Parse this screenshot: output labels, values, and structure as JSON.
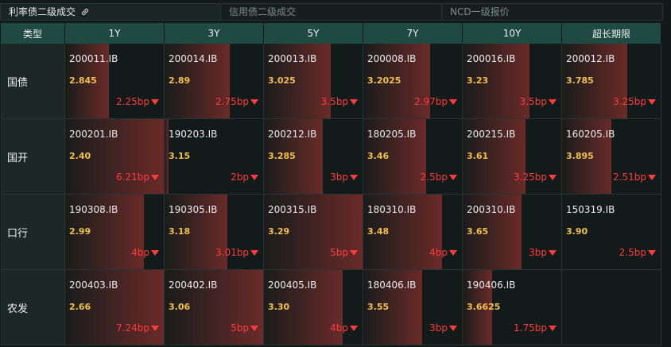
{
  "tabs": [
    {
      "label": "利率债二级成交",
      "active": true
    },
    {
      "label": "信用债二级成交",
      "active": false
    },
    {
      "label": "NCD一级报价",
      "active": false
    }
  ],
  "columns": [
    "类型",
    "1Y",
    "3Y",
    "5Y",
    "7Y",
    "10Y",
    "超长期限"
  ],
  "rows": [
    {
      "label": "国债",
      "cells": [
        {
          "code": "200011.IB",
          "yield": "2.845",
          "change": "2.25bp",
          "fill": 0.44
        },
        {
          "code": "200014.IB",
          "yield": "2.89",
          "change": "2.75bp",
          "fill": 0.66
        },
        {
          "code": "200013.IB",
          "yield": "3.025",
          "change": "3.5bp",
          "fill": 0.68
        },
        {
          "code": "200008.IB",
          "yield": "3.2025",
          "change": "2.97bp",
          "fill": 0.68
        },
        {
          "code": "200016.IB",
          "yield": "3.23",
          "change": "3.5bp",
          "fill": 0.68
        },
        {
          "code": "200012.IB",
          "yield": "3.785",
          "change": "3.25bp",
          "fill": 0.66
        }
      ]
    },
    {
      "label": "国开",
      "cells": [
        {
          "code": "200201.IB",
          "yield": "2.40",
          "change": "6.21bp",
          "fill": 1.0
        },
        {
          "code": "190203.IB",
          "yield": "3.15",
          "change": "2bp",
          "fill": 0.04
        },
        {
          "code": "200212.IB",
          "yield": "3.285",
          "change": "3bp",
          "fill": 0.6
        },
        {
          "code": "180205.IB",
          "yield": "3.46",
          "change": "2.5bp",
          "fill": 0.64
        },
        {
          "code": "200215.IB",
          "yield": "3.61",
          "change": "3.25bp",
          "fill": 0.64
        },
        {
          "code": "160205.IB",
          "yield": "3.895",
          "change": "2.51bp",
          "fill": 0.5
        }
      ]
    },
    {
      "label": "口行",
      "cells": [
        {
          "code": "190308.IB",
          "yield": "2.99",
          "change": "4bp",
          "fill": 0.8
        },
        {
          "code": "190305.IB",
          "yield": "3.18",
          "change": "3.01bp",
          "fill": 0.64
        },
        {
          "code": "200315.IB",
          "yield": "3.29",
          "change": "5bp",
          "fill": 1.0
        },
        {
          "code": "180310.IB",
          "yield": "3.48",
          "change": "4bp",
          "fill": 0.8
        },
        {
          "code": "200310.IB",
          "yield": "3.65",
          "change": "3bp",
          "fill": 0.6
        },
        {
          "code": "150319.IB",
          "yield": "3.90",
          "change": "2.5bp",
          "fill": 0.0
        }
      ]
    },
    {
      "label": "农发",
      "cells": [
        {
          "code": "200403.IB",
          "yield": "2.66",
          "change": "7.24bp",
          "fill": 1.0
        },
        {
          "code": "200402.IB",
          "yield": "3.06",
          "change": "5bp",
          "fill": 1.0
        },
        {
          "code": "200405.IB",
          "yield": "3.30",
          "change": "4bp",
          "fill": 0.8
        },
        {
          "code": "180406.IB",
          "yield": "3.55",
          "change": "3bp",
          "fill": 0.6
        },
        {
          "code": "190406.IB",
          "yield": "3.6625",
          "change": "1.75bp",
          "fill": 0.3
        },
        null
      ]
    }
  ],
  "colors": {
    "header_bg": "#1e4a41",
    "yield": "#f1c04a",
    "change_down": "#ff3b3b",
    "heat": "#6a2a28"
  },
  "icons": {
    "tab_link": "link-icon",
    "change": "down-arrow-icon"
  }
}
